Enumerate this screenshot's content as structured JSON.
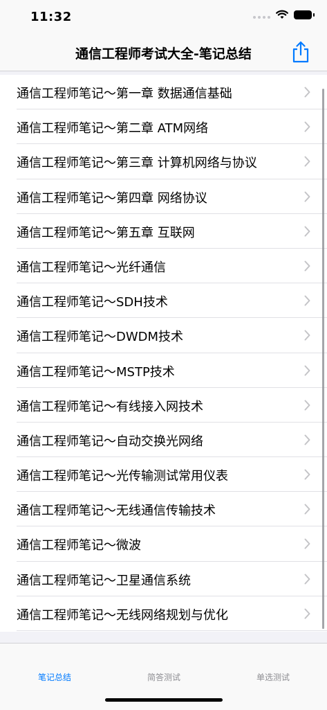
{
  "status": {
    "time": "11:32"
  },
  "nav": {
    "title": "通信工程师考试大全-笔记总结",
    "share_icon": "share-icon"
  },
  "list": {
    "items": [
      "通信工程师笔记～第一章 数据通信基础",
      "通信工程师笔记～第二章 ATM网络",
      "通信工程师笔记～第三章  计算机网络与协议",
      "通信工程师笔记～第四章 网络协议",
      "通信工程师笔记～第五章  互联网",
      "通信工程师笔记～光纤通信",
      "通信工程师笔记～SDH技术",
      "通信工程师笔记～DWDM技术",
      "通信工程师笔记～MSTP技术",
      "通信工程师笔记～有线接入网技术",
      "通信工程师笔记～自动交换光网络",
      "通信工程师笔记～光传输测试常用仪表",
      "通信工程师笔记～无线通信传输技术",
      "通信工程师笔记～微波",
      "通信工程师笔记～卫星通信系统",
      "通信工程师笔记～无线网络规划与优化"
    ]
  },
  "tabs": [
    {
      "label": "笔记总结",
      "active": true
    },
    {
      "label": "简答测试",
      "active": false
    },
    {
      "label": "单选测试",
      "active": false
    }
  ],
  "colors": {
    "accent": "#007aff",
    "inactive": "#8e8e93",
    "chevron": "#c4c4c7"
  }
}
